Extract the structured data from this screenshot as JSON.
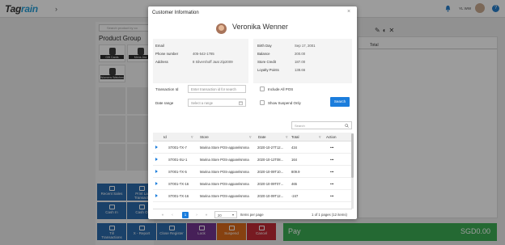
{
  "app": {
    "logo_prefix": "Tag",
    "logo_suffix": "rain",
    "user_name": "YL WW",
    "help": "?",
    "search_placeholder": "Search product by co",
    "product_group_title": "Product Group",
    "tiles": [
      {
        "label": "Gift Cards"
      },
      {
        "label": "Mens Jea"
      },
      {
        "label": "Womens Watches"
      }
    ],
    "cart_total_header": "Total",
    "function_buttons": [
      {
        "label1": "Recent Sales",
        "label2": ""
      },
      {
        "label1": "Print La",
        "label2": "Transacti"
      },
      {
        "label1": "Cash In",
        "label2": ""
      },
      {
        "label1": "Cash O",
        "label2": ""
      },
      {
        "label1": "Till",
        "label2": "Transactions"
      },
      {
        "label1": "X - Report",
        "label2": ""
      },
      {
        "label1": "Close Register",
        "label2": ""
      },
      {
        "label1": "Lock",
        "label2": ""
      },
      {
        "label1": "Suspend",
        "label2": ""
      },
      {
        "label1": "Cancel",
        "label2": ""
      }
    ],
    "pay_label": "Pay",
    "pay_amount": "SGD0.00"
  },
  "modal": {
    "title": "Customer Information",
    "close": "×",
    "customer_name": "Veronika Wenner",
    "info_left": [
      {
        "label": "Email",
        "value": ""
      },
      {
        "label": "Phone number",
        "value": "405-542-1785"
      },
      {
        "label": "Address",
        "value": "8 Silvershoff Jaat Zip2009"
      }
    ],
    "info_right": [
      {
        "label": "Birth Day",
        "value": "Sep 17, 2001"
      },
      {
        "label": "Balance",
        "value": "200.00"
      },
      {
        "label": "Store Credit",
        "value": "187.00"
      },
      {
        "label": "Loyalty Points",
        "value": "138.66"
      }
    ],
    "transaction_id_label": "Transaction Id",
    "transaction_id_placeholder": "Enter transaction id for search",
    "date_range_label": "Date range",
    "date_range_placeholder": "Select a range",
    "include_all_pos": "Include All POS",
    "show_suspend_only": "Show Suspend Only",
    "search_button": "Search",
    "table_search_placeholder": "Search",
    "columns": [
      "Id",
      "Store",
      "Date",
      "Total",
      "Action"
    ],
    "rows": [
      {
        "id": "ST001-TX-7",
        "store": "Marina Store POS-apparelsmma",
        "date": "2020-10-27T12...",
        "total": "434",
        "action": "•••"
      },
      {
        "id": "ST001-SU-1",
        "store": "Marina Store POS-apparelsmma",
        "date": "2020-10-12T08...",
        "total": "164",
        "action": "•••"
      },
      {
        "id": "ST001-TX-5",
        "store": "Marina Store POS-apparelsmma",
        "date": "2020-10-09T10...",
        "total": "809.9",
        "action": "•••"
      },
      {
        "id": "ST001-TX-16",
        "store": "Marina Store POS-apparelsmma",
        "date": "2020-10-09T07...",
        "total": "465",
        "action": "•••"
      },
      {
        "id": "ST001-TX-16",
        "store": "Marina Store POS-apparelsmma",
        "date": "2020-10-09T12...",
        "total": "-247",
        "action": "•••"
      }
    ],
    "pagination": {
      "current_page": "1",
      "page_size": "20",
      "items_per_page": "Items per page",
      "summary": "1 of 1 pages (12 items)"
    }
  },
  "colors": {
    "brand_blue": "#1b9ad6",
    "primary": "#1b7ddc",
    "pay_green": "#31a84b",
    "suspend_orange": "#d9630e",
    "cancel_red": "#c0202b",
    "lock_purple": "#6b2a8a"
  }
}
